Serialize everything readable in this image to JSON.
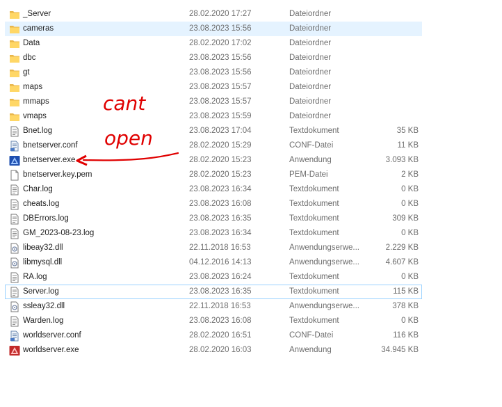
{
  "files": [
    {
      "name": "_Server",
      "date": "28.02.2020 17:27",
      "type": "Dateiordner",
      "size": "",
      "icon": "folder-icon"
    },
    {
      "name": "cameras",
      "date": "23.08.2023 15:56",
      "type": "Dateiordner",
      "size": "",
      "icon": "folder-icon",
      "hover": true
    },
    {
      "name": "Data",
      "date": "28.02.2020 17:02",
      "type": "Dateiordner",
      "size": "",
      "icon": "folder-icon"
    },
    {
      "name": "dbc",
      "date": "23.08.2023 15:56",
      "type": "Dateiordner",
      "size": "",
      "icon": "folder-icon"
    },
    {
      "name": "gt",
      "date": "23.08.2023 15:56",
      "type": "Dateiordner",
      "size": "",
      "icon": "folder-icon"
    },
    {
      "name": "maps",
      "date": "23.08.2023 15:57",
      "type": "Dateiordner",
      "size": "",
      "icon": "folder-icon"
    },
    {
      "name": "mmaps",
      "date": "23.08.2023 15:57",
      "type": "Dateiordner",
      "size": "",
      "icon": "folder-icon"
    },
    {
      "name": "vmaps",
      "date": "23.08.2023 15:59",
      "type": "Dateiordner",
      "size": "",
      "icon": "folder-icon"
    },
    {
      "name": "Bnet.log",
      "date": "23.08.2023 17:04",
      "type": "Textdokument",
      "size": "35 KB",
      "icon": "text-file-icon"
    },
    {
      "name": "bnetserver.conf",
      "date": "28.02.2020 15:29",
      "type": "CONF-Datei",
      "size": "11 KB",
      "icon": "conf-file-icon"
    },
    {
      "name": "bnetserver.exe",
      "date": "28.02.2020 15:23",
      "type": "Anwendung",
      "size": "3.093 KB",
      "icon": "bnet-exe-icon"
    },
    {
      "name": "bnetserver.key.pem",
      "date": "28.02.2020 15:23",
      "type": "PEM-Datei",
      "size": "2 KB",
      "icon": "blank-file-icon"
    },
    {
      "name": "Char.log",
      "date": "23.08.2023 16:34",
      "type": "Textdokument",
      "size": "0 KB",
      "icon": "text-file-icon"
    },
    {
      "name": "cheats.log",
      "date": "23.08.2023 16:08",
      "type": "Textdokument",
      "size": "0 KB",
      "icon": "text-file-icon"
    },
    {
      "name": "DBErrors.log",
      "date": "23.08.2023 16:35",
      "type": "Textdokument",
      "size": "309 KB",
      "icon": "text-file-icon"
    },
    {
      "name": "GM_2023-08-23.log",
      "date": "23.08.2023 16:34",
      "type": "Textdokument",
      "size": "0 KB",
      "icon": "text-file-icon"
    },
    {
      "name": "libeay32.dll",
      "date": "22.11.2018 16:53",
      "type": "Anwendungserwe...",
      "size": "2.229 KB",
      "icon": "dll-file-icon"
    },
    {
      "name": "libmysql.dll",
      "date": "04.12.2016 14:13",
      "type": "Anwendungserwe...",
      "size": "4.607 KB",
      "icon": "dll-file-icon"
    },
    {
      "name": "RA.log",
      "date": "23.08.2023 16:24",
      "type": "Textdokument",
      "size": "0 KB",
      "icon": "text-file-icon"
    },
    {
      "name": "Server.log",
      "date": "23.08.2023 16:35",
      "type": "Textdokument",
      "size": "115 KB",
      "icon": "text-file-icon",
      "focused": true
    },
    {
      "name": "ssleay32.dll",
      "date": "22.11.2018 16:53",
      "type": "Anwendungserwe...",
      "size": "378 KB",
      "icon": "dll-file-icon"
    },
    {
      "name": "Warden.log",
      "date": "23.08.2023 16:08",
      "type": "Textdokument",
      "size": "0 KB",
      "icon": "text-file-icon"
    },
    {
      "name": "worldserver.conf",
      "date": "28.02.2020 16:51",
      "type": "CONF-Datei",
      "size": "116 KB",
      "icon": "conf-file-icon"
    },
    {
      "name": "worldserver.exe",
      "date": "28.02.2020 16:03",
      "type": "Anwendung",
      "size": "34.945 KB",
      "icon": "world-exe-icon"
    }
  ],
  "annotation": {
    "line1": "cant",
    "line2": "open",
    "color": "#e00000"
  }
}
